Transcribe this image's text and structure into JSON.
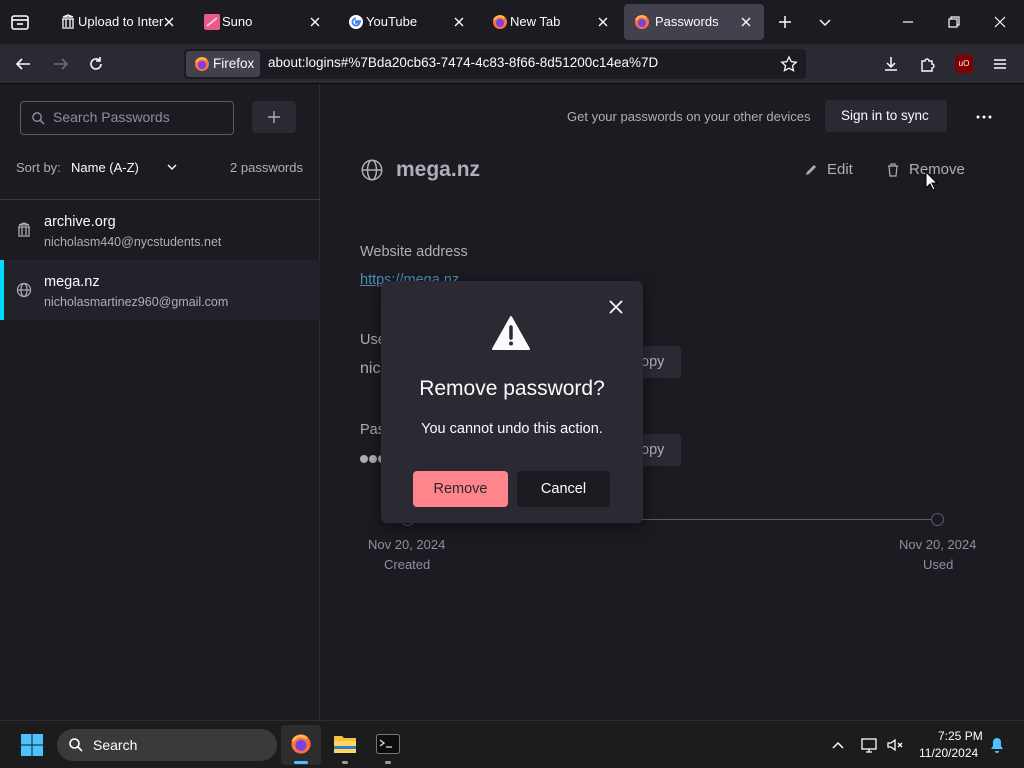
{
  "tabs": [
    {
      "label": "Upload to Intern",
      "icon": "archive-icon"
    },
    {
      "label": "Suno",
      "icon": "suno-icon"
    },
    {
      "label": "YouTube",
      "icon": "google-icon"
    },
    {
      "label": "New Tab",
      "icon": "firefox-icon"
    },
    {
      "label": "Passwords",
      "icon": "firefox-icon"
    }
  ],
  "navbar": {
    "identity_label": "Firefox",
    "url": "about:logins#%7Bda20cb63-7474-4c83-8f66-8d51200c14ea%7D"
  },
  "sidebar": {
    "search_placeholder": "Search Passwords",
    "sort_label": "Sort by:",
    "sort_value": "Name (A-Z)",
    "count": "2 passwords",
    "items": [
      {
        "title": "archive.org",
        "user": "nicholasm440@nycstudents.net"
      },
      {
        "title": "mega.nz",
        "user": "nicholasmartinez960@gmail.com"
      }
    ]
  },
  "main": {
    "sync_text": "Get your passwords on your other devices",
    "sync_button": "Sign in to sync",
    "login_title": "mega.nz",
    "edit_label": "Edit",
    "remove_label": "Remove",
    "website_label": "Website address",
    "website_value": "https://mega.nz",
    "username_label_partial": "Use",
    "username_value_partial": "nic",
    "password_label_partial": "Pas",
    "copy_label_partial": "opy",
    "created_date": "Nov 20, 2024",
    "created_label": "Created",
    "used_date": "Nov 20, 2024",
    "used_label": "Used"
  },
  "dialog": {
    "title": "Remove password?",
    "message": "You cannot undo this action.",
    "confirm": "Remove",
    "cancel": "Cancel"
  },
  "taskbar": {
    "search_label": "Search",
    "time": "7:25 PM",
    "date": "11/20/2024"
  },
  "colors": {
    "accent": "#00ddff",
    "danger_button": "#ff848b",
    "dialog_bg": "#2b2a33"
  }
}
